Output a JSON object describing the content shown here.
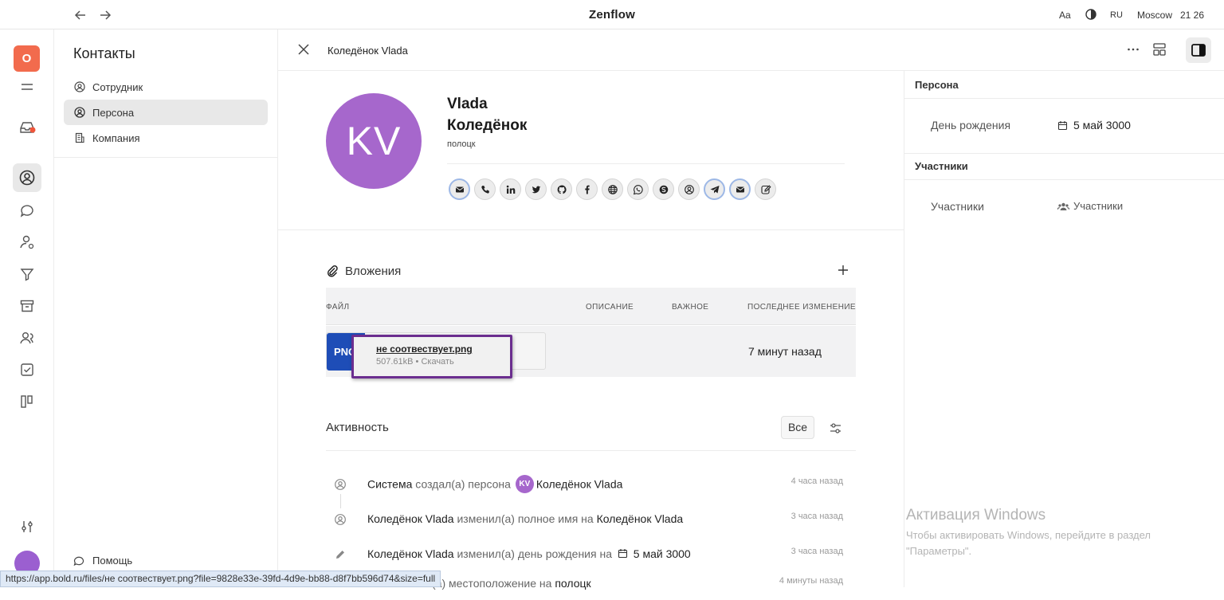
{
  "app": {
    "title": "Zenflow"
  },
  "topbar": {
    "font_label": "Aa",
    "lang": "RU",
    "location": "Moscow",
    "time": "21 26"
  },
  "rail": {
    "workspace_initial": "O"
  },
  "contacts": {
    "title": "Контакты",
    "items": [
      {
        "label": "Сотрудник",
        "icon": "user-circle-icon",
        "active": false
      },
      {
        "label": "Персона",
        "icon": "user-circle-icon",
        "active": true
      },
      {
        "label": "Компания",
        "icon": "building-icon",
        "active": false
      }
    ],
    "help_label": "Помощь"
  },
  "record": {
    "title": "Коледёнок Vlada",
    "avatar_initials": "KV",
    "first_name": "Vlada",
    "last_name": "Коледёнок",
    "location": "полоцк",
    "social": [
      "email-icon",
      "phone-icon",
      "linkedin-icon",
      "twitter-icon",
      "github-icon",
      "facebook-icon",
      "globe-icon",
      "whatsapp-icon",
      "skype-icon",
      "user-icon",
      "telegram-icon",
      "email-icon",
      "edit-icon"
    ]
  },
  "attachments": {
    "title": "Вложения",
    "columns": {
      "file": "ФАЙЛ",
      "description": "ОПИСАНИЕ",
      "important": "ВАЖНОЕ",
      "last_modified": "ПОСЛЕДНЕЕ ИЗМЕНЕНИЕ"
    },
    "file": {
      "type": "PNG",
      "name": "не соотвествует.png",
      "meta": "507.61kB • Скачать",
      "modified": "7 минут назад"
    }
  },
  "activity": {
    "title": "Активность",
    "filter_label": "Все",
    "items": [
      {
        "actor": "Система",
        "action": "создал(а) персона",
        "avatar": "KV",
        "target": "Коледёнок Vlada",
        "time": "4 часа назад"
      },
      {
        "actor": "Коледёнок Vlada",
        "action": "изменил(а) полное имя на",
        "target": "Коледёнок Vlada",
        "time": "3 часа назад"
      },
      {
        "actor": "Коледёнок Vlada",
        "action": "изменил(а) день рождения на",
        "target": "5 май 3000",
        "time": "3 часа назад"
      },
      {
        "actor": "…а",
        "action": "изменил(а) местоположение на",
        "target": "полоцк",
        "time": "4 минуты назад"
      }
    ]
  },
  "right_panel": {
    "person_section": "Персона",
    "birthday_label": "День рождения",
    "birthday_value": "5 май 3000",
    "participants_section": "Участники",
    "participants_label": "Участники",
    "participants_value": "Участники"
  },
  "watermark": {
    "title": "Активация Windows",
    "line1": "Чтобы активировать Windows, перейдите в раздел",
    "line2": "\"Параметры\"."
  },
  "status_bar": {
    "url": "https://app.bold.ru/files/не соотвествует.png?file=9828e33e-39fd-4d9e-bb88-d8f7bb596d74&size=full"
  },
  "colors": {
    "avatar": "#a667cc",
    "file_png": "#1e4db7",
    "workspace": "#f26b4d",
    "highlight": "#6b2e8f"
  }
}
